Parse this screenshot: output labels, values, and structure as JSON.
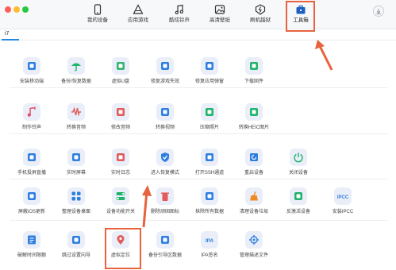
{
  "nav": {
    "items": [
      {
        "label": "我的设备",
        "icon": "phone-icon"
      },
      {
        "label": "应用游戏",
        "icon": "apps-icon"
      },
      {
        "label": "酷炫铃声",
        "icon": "music-note-icon"
      },
      {
        "label": "高清壁纸",
        "icon": "wallpaper-icon"
      },
      {
        "label": "刷机越狱",
        "icon": "flash-icon"
      },
      {
        "label": "工具箱",
        "icon": "toolbox-icon"
      }
    ],
    "active": "工具箱"
  },
  "device_tab": {
    "label": "i7"
  },
  "colors": {
    "accent": "#1e88e5",
    "highlight": "#e7623d",
    "icon_bg": "#e9eef8",
    "titlebar": "#f7f8fa"
  },
  "tools": [
    [
      {
        "label": "安装移动端",
        "icon": "install-mobile-icon",
        "color": "#2f7fe0"
      },
      {
        "label": "备份/恢复数据",
        "icon": "umbrella-icon",
        "color": "#20b36b"
      },
      {
        "label": "虚拟U盘",
        "icon": "usb-drive-icon",
        "color": "#34b46e"
      },
      {
        "label": "修复游戏失效",
        "icon": "gamepad-repair-icon",
        "color": "#2f7fe0"
      },
      {
        "label": "修复应用弹窗",
        "icon": "app-repair-icon",
        "color": "#2f7fe0"
      },
      {
        "label": "下载固件",
        "icon": "download-firmware-icon",
        "color": "#20b36b"
      }
    ],
    [
      {
        "label": "制作铃声",
        "icon": "ringtone-icon",
        "color": "#e84a6a"
      },
      {
        "label": "转换音频",
        "icon": "audio-wave-icon",
        "color": "#e25a5a"
      },
      {
        "label": "修改音频",
        "icon": "audio-edit-icon",
        "color": "#e25a5a"
      },
      {
        "label": "转换视频",
        "icon": "video-convert-icon",
        "color": "#2f7fe0"
      },
      {
        "label": "压缩照片",
        "icon": "compress-photo-icon",
        "color": "#20b36b"
      },
      {
        "label": "转换HEIC图片",
        "icon": "heic-convert-icon",
        "color": "#20b36b"
      }
    ],
    [
      {
        "label": "手机投屏直播",
        "icon": "screen-mirror-icon",
        "color": "#2f7fe0"
      },
      {
        "label": "实时屏幕",
        "icon": "live-screen-icon",
        "color": "#2f7fe0"
      },
      {
        "label": "实时日志",
        "icon": "live-log-icon",
        "color": "#e25a5a"
      },
      {
        "label": "进入恢复模式",
        "icon": "shield-icon",
        "color": "#2f7fe0"
      },
      {
        "label": "打开SSH通道",
        "icon": "terminal-icon",
        "color": "#2f7fe0"
      },
      {
        "label": "重启设备",
        "icon": "restart-icon",
        "color": "#2f7fe0"
      },
      {
        "label": "关闭设备",
        "icon": "power-icon",
        "color": "#20b36b"
      }
    ],
    [
      {
        "label": "屏蔽iOS更新",
        "icon": "block-update-icon",
        "color": "#2f7fe0"
      },
      {
        "label": "整理设备桌面",
        "icon": "grid-icon",
        "color": "#2f7fe0"
      },
      {
        "label": "设备功能开关",
        "icon": "toggle-icon",
        "color": "#20b36b"
      },
      {
        "label": "删除顽固图标",
        "icon": "trash-icon",
        "color": "#e25a5a"
      },
      {
        "label": "抹除所有数据",
        "icon": "erase-icon",
        "color": "#2f7fe0"
      },
      {
        "label": "清理设备垃圾",
        "icon": "broom-icon",
        "color": "#f08a24"
      },
      {
        "label": "反激活设备",
        "icon": "deactivate-icon",
        "color": "#20b36b"
      },
      {
        "label": "安装IPCC",
        "icon": "ipcc-icon",
        "color": "#2f7fe0"
      }
    ],
    [
      {
        "label": "破解时间限额",
        "icon": "clock-icon",
        "color": "#2f7fe0"
      },
      {
        "label": "跳过设置向导",
        "icon": "skip-setup-icon",
        "color": "#2f7fe0"
      },
      {
        "label": "虚拟定位",
        "icon": "location-pin-icon",
        "color": "#e25a5a"
      },
      {
        "label": "备份引导区数据",
        "icon": "boot-backup-icon",
        "color": "#2f7fe0"
      },
      {
        "label": "IPA签名",
        "icon": "ipa-icon",
        "color": "#2f7fe0"
      },
      {
        "label": "管理描述文件",
        "icon": "gear-icon",
        "color": "#2f7fe0"
      }
    ]
  ]
}
